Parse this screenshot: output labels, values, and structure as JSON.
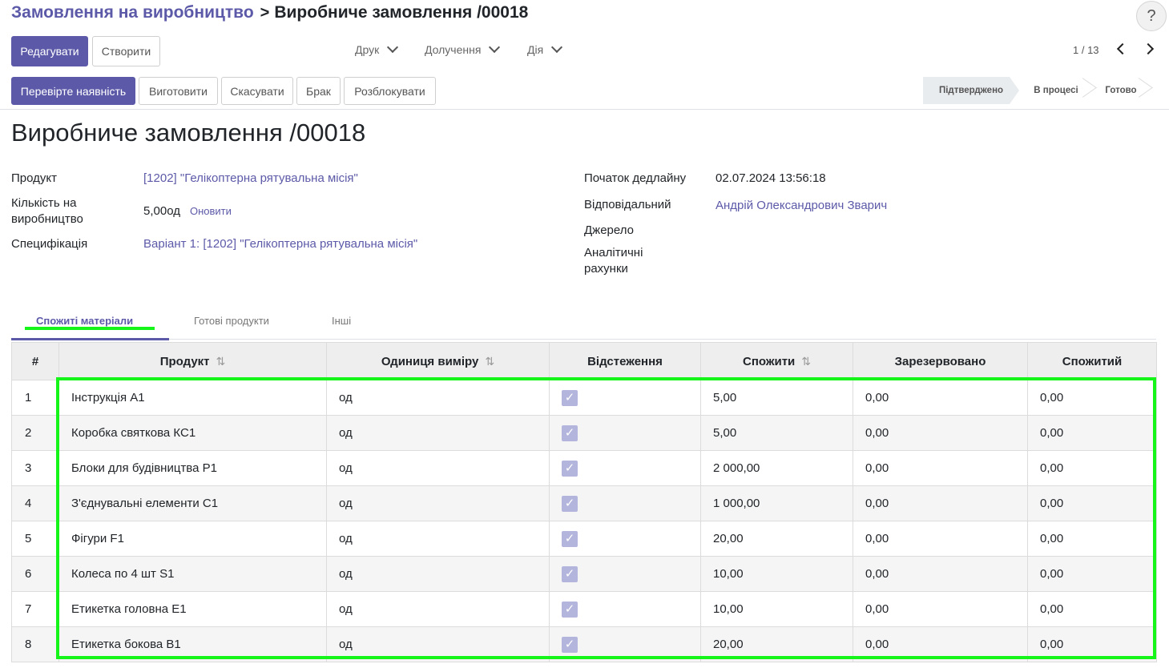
{
  "breadcrumb": {
    "parent": "Замовлення на виробництво",
    "separator": ">",
    "current": "Виробниче замовлення /00018"
  },
  "help_label": "?",
  "toolbar": {
    "edit_label": "Редагувати",
    "create_label": "Створити",
    "print_label": "Друк",
    "attach_label": "Долучення",
    "action_label": "Дія",
    "pager": "1 / 13"
  },
  "actions": {
    "check_label": "Перевірте наявність",
    "produce_label": "Виготовити",
    "cancel_label": "Скасувати",
    "scrap_label": "Брак",
    "unlock_label": "Розблокувати"
  },
  "status": {
    "stages": [
      "Підтверджено",
      "В процесі",
      "Готово"
    ],
    "active": "Підтверджено"
  },
  "form": {
    "title": "Виробниче замовлення /00018",
    "product_label": "Продукт",
    "product_value": "[1202] \"Гелікоптерна рятувальна місія\"",
    "qty_label": "Кількість на виробництво",
    "qty_value": "5,00од",
    "qty_update": "Оновити",
    "bom_label": "Специфікація",
    "bom_value": "Варіант 1: [1202] \"Гелікоптерна рятувальна місія\"",
    "deadline_label": "Початок дедлайну",
    "deadline_value": "02.07.2024 13:56:18",
    "responsible_label": "Відповідальний",
    "responsible_value": "Андрій Олександрович Зварич",
    "source_label": "Джерело",
    "analytic_label": "Аналітичні рахунки"
  },
  "tabs": [
    "Спожиті матеріали",
    "Готові продукти",
    "Інші"
  ],
  "table": {
    "headers": [
      "#",
      "Продукт",
      "Одиниця виміру",
      "Відстеження",
      "Спожити",
      "Зарезервовано",
      "Спожитий"
    ],
    "rows": [
      {
        "n": "1",
        "product": "Інструкція А1",
        "uom": "од",
        "tracked": true,
        "to_consume": "5,00",
        "reserved": "0,00",
        "consumed": "0,00"
      },
      {
        "n": "2",
        "product": "Коробка святкова КС1",
        "uom": "од",
        "tracked": true,
        "to_consume": "5,00",
        "reserved": "0,00",
        "consumed": "0,00"
      },
      {
        "n": "3",
        "product": "Блоки для будівництва Р1",
        "uom": "од",
        "tracked": true,
        "to_consume": "2 000,00",
        "reserved": "0,00",
        "consumed": "0,00"
      },
      {
        "n": "4",
        "product": "З'єднувальні елементи С1",
        "uom": "од",
        "tracked": true,
        "to_consume": "1 000,00",
        "reserved": "0,00",
        "consumed": "0,00"
      },
      {
        "n": "5",
        "product": "Фігури F1",
        "uom": "од",
        "tracked": true,
        "to_consume": "20,00",
        "reserved": "0,00",
        "consumed": "0,00"
      },
      {
        "n": "6",
        "product": "Колеса по 4 шт S1",
        "uom": "од",
        "tracked": true,
        "to_consume": "10,00",
        "reserved": "0,00",
        "consumed": "0,00"
      },
      {
        "n": "7",
        "product": "Етикетка головна Е1",
        "uom": "од",
        "tracked": true,
        "to_consume": "10,00",
        "reserved": "0,00",
        "consumed": "0,00"
      },
      {
        "n": "8",
        "product": "Етикетка бокова В1",
        "uom": "од",
        "tracked": true,
        "to_consume": "20,00",
        "reserved": "0,00",
        "consumed": "0,00"
      }
    ]
  },
  "colors": {
    "brand": "#5c5aa8",
    "highlight": "#16f51a",
    "check_fill": "#b3b5dc"
  }
}
